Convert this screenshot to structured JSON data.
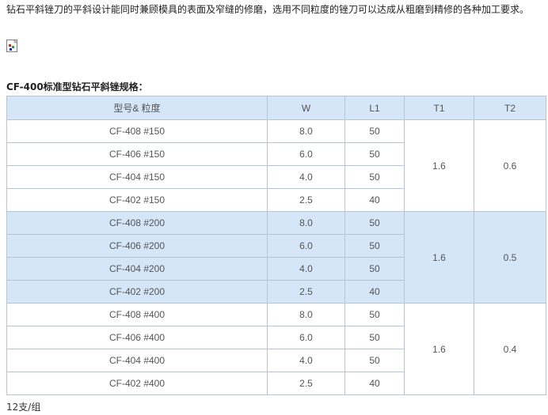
{
  "intro_text": "钻石平斜锉刀的平斜设计能同时兼顾模具的表面及窄缝的修磨，选用不同粒度的锉刀可以达成从粗磨到精修的各种加工要求。",
  "broken_image_icon": "broken-image-icon",
  "spec_title": "CF-400标准型钻石平斜锉规格：",
  "table": {
    "headers": [
      "型号& 粒度",
      "W",
      "L1",
      "T1",
      "T2"
    ],
    "groups": [
      {
        "shaded": false,
        "t1": "1.6",
        "t2": "0.6",
        "rows": [
          {
            "model": "CF-408 #150",
            "w": "8.0",
            "l1": "50"
          },
          {
            "model": "CF-406 #150",
            "w": "6.0",
            "l1": "50"
          },
          {
            "model": "CF-404 #150",
            "w": "4.0",
            "l1": "50"
          },
          {
            "model": "CF-402 #150",
            "w": "2.5",
            "l1": "40"
          }
        ]
      },
      {
        "shaded": true,
        "t1": "1.6",
        "t2": "0.5",
        "rows": [
          {
            "model": "CF-408 #200",
            "w": "8.0",
            "l1": "50"
          },
          {
            "model": "CF-406 #200",
            "w": "6.0",
            "l1": "50"
          },
          {
            "model": "CF-404 #200",
            "w": "4.0",
            "l1": "50"
          },
          {
            "model": "CF-402 #200",
            "w": "2.5",
            "l1": "40"
          }
        ]
      },
      {
        "shaded": false,
        "t1": "1.6",
        "t2": "0.4",
        "rows": [
          {
            "model": "CF-408 #400",
            "w": "8.0",
            "l1": "50"
          },
          {
            "model": "CF-406 #400",
            "w": "6.0",
            "l1": "50"
          },
          {
            "model": "CF-404 #400",
            "w": "4.0",
            "l1": "50"
          },
          {
            "model": "CF-402 #400",
            "w": "2.5",
            "l1": "40"
          }
        ]
      }
    ]
  },
  "footer_text": "12支/组",
  "colors": {
    "header_bg": "#d4e6f7",
    "shaded_row_bg": "#d4e6f7",
    "border": "#b8c4d0"
  }
}
